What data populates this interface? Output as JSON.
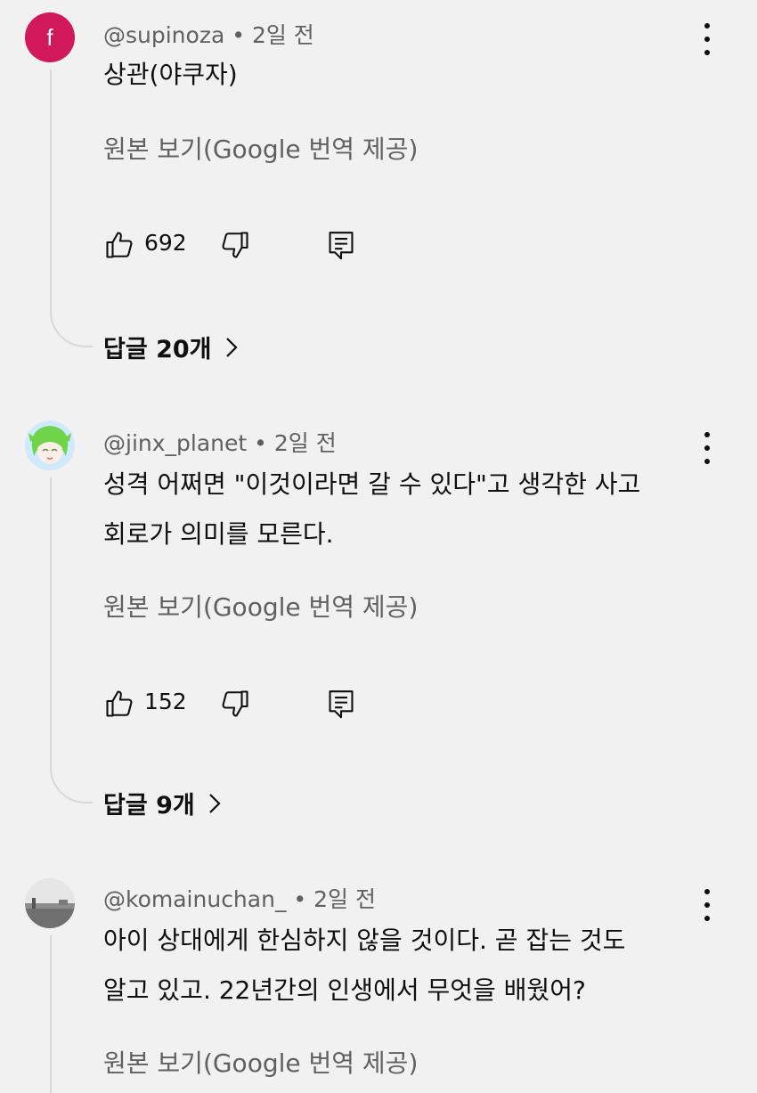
{
  "comments": [
    {
      "author": "@supinoza",
      "time": "2일 전",
      "avatar_letter": "f",
      "text_lines": [
        "상관(야쿠자)"
      ],
      "translate": "원본 보기(Google 번역 제공)",
      "likes": "692",
      "replies": "답글 20개"
    },
    {
      "author": "@jinx_planet",
      "time": "2일 전",
      "text_lines": [
        "성격 어쩌면 \"이것이라면 갈 수 있다\"고 생각한 사고",
        "회로가 의미를 모른다."
      ],
      "translate": "원본 보기(Google 번역 제공)",
      "likes": "152",
      "replies": "답글 9개"
    },
    {
      "author": "@komainuchan_",
      "time": "2일 전",
      "text_lines": [
        "아이 상대에게 한심하지 않을 것이다. 곧 잡는 것도",
        "알고 있고. 22년간의 인생에서 무엇을 배웠어?"
      ],
      "translate": "원본 보기(Google 번역 제공)"
    }
  ],
  "separator": "•",
  "icons": [
    "thumbs-up-icon",
    "thumbs-down-icon",
    "reply-comment-icon",
    "more-vert-icon",
    "chevron-right-icon"
  ]
}
